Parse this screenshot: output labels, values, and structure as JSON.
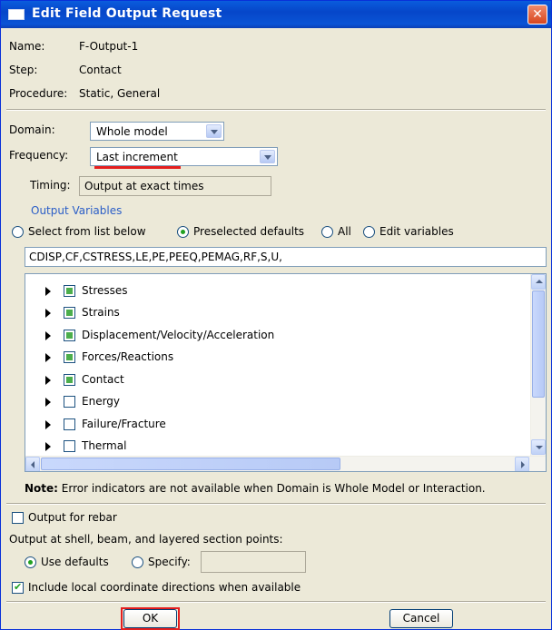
{
  "window": {
    "title": "Edit Field Output Request",
    "close_glyph": "✕"
  },
  "info": {
    "name_label": "Name:",
    "name_value": "F-Output-1",
    "step_label": "Step:",
    "step_value": "Contact",
    "procedure_label": "Procedure:",
    "procedure_value": "Static, General"
  },
  "domain": {
    "label": "Domain:",
    "value": "Whole model"
  },
  "frequency": {
    "label": "Frequency:",
    "value": "Last increment"
  },
  "timing": {
    "label": "Timing:",
    "value": "Output at exact times"
  },
  "output_variables": {
    "group_title": "Output Variables",
    "radio_options": [
      {
        "label": "Select from list below",
        "checked": false
      },
      {
        "label": "Preselected defaults",
        "checked": true
      },
      {
        "label": "All",
        "checked": false
      },
      {
        "label": "Edit variables",
        "checked": false
      }
    ],
    "variables_text": "CDISP,CF,CSTRESS,LE,PE,PEEQ,PEMAG,RF,S,U,",
    "tree_items": [
      {
        "label": "Stresses",
        "state": "partial"
      },
      {
        "label": "Strains",
        "state": "partial"
      },
      {
        "label": "Displacement/Velocity/Acceleration",
        "state": "partial"
      },
      {
        "label": "Forces/Reactions",
        "state": "partial"
      },
      {
        "label": "Contact",
        "state": "partial"
      },
      {
        "label": "Energy",
        "state": "unchecked"
      },
      {
        "label": "Failure/Fracture",
        "state": "unchecked"
      },
      {
        "label": "Thermal",
        "state": "unchecked"
      }
    ]
  },
  "note": {
    "bold": "Note:",
    "text": "Error indicators are not available when Domain is Whole Model or Interaction."
  },
  "rebar": {
    "label": "Output for rebar",
    "checked": false
  },
  "section_points": {
    "label": "Output at shell, beam, and layered section points:",
    "use_defaults_label": "Use defaults",
    "specify_label": "Specify:"
  },
  "local_coords": {
    "label": "Include local coordinate directions when available",
    "checked": true
  },
  "buttons": {
    "ok": "OK",
    "cancel": "Cancel"
  },
  "colors": {
    "title_bar": "#0a5ddd",
    "highlight_red": "#e51e1e",
    "group_title": "#2b5ec7",
    "dialog_bg": "#ece9d8"
  }
}
